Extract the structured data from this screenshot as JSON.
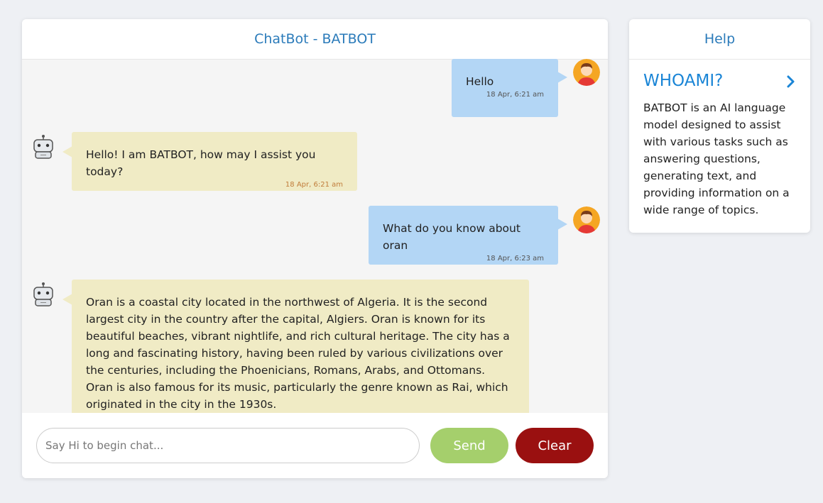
{
  "chat": {
    "title": "ChatBot - BATBOT",
    "messages": [
      {
        "sender": "user",
        "text": "Hello",
        "time": "18 Apr, 6:21 am"
      },
      {
        "sender": "bot",
        "text": "Hello! I am BATBOT, how may I assist you today?",
        "time": "18 Apr, 6:21 am"
      },
      {
        "sender": "user",
        "text": "What do you know about oran",
        "time": "18 Apr, 6:23 am"
      },
      {
        "sender": "bot",
        "text": "Oran is a coastal city located in the northwest of Algeria. It is the second largest city in the country after the capital, Algiers. Oran is known for its beautiful beaches, vibrant nightlife, and rich cultural heritage. The city has a long and fascinating history, having been ruled by various civilizations over the centuries, including the Phoenicians, Romans, Arabs, and Ottomans. Oran is also famous for its music, particularly the genre known as Rai, which originated in the city in the 1930s.",
        "time": ""
      }
    ],
    "input_placeholder": "Say Hi to begin chat...",
    "input_value": "",
    "send_label": "Send",
    "clear_label": "Clear"
  },
  "help": {
    "title": "Help",
    "item_title": "WHOAMI?",
    "item_text": "BATBOT is an AI language model designed to assist with various tasks such as answering questions, generating text, and providing information on a wide range of topics."
  },
  "colors": {
    "accent": "#2b7bba",
    "user_bubble": "#b3d6f5",
    "bot_bubble": "#f0ebc5",
    "send_button": "#a5cf6c",
    "clear_button": "#9a1010"
  },
  "icons": {
    "user_avatar": "user-avatar-icon",
    "bot_avatar": "robot-avatar-icon",
    "help_chevron": "chevron-right-icon"
  }
}
